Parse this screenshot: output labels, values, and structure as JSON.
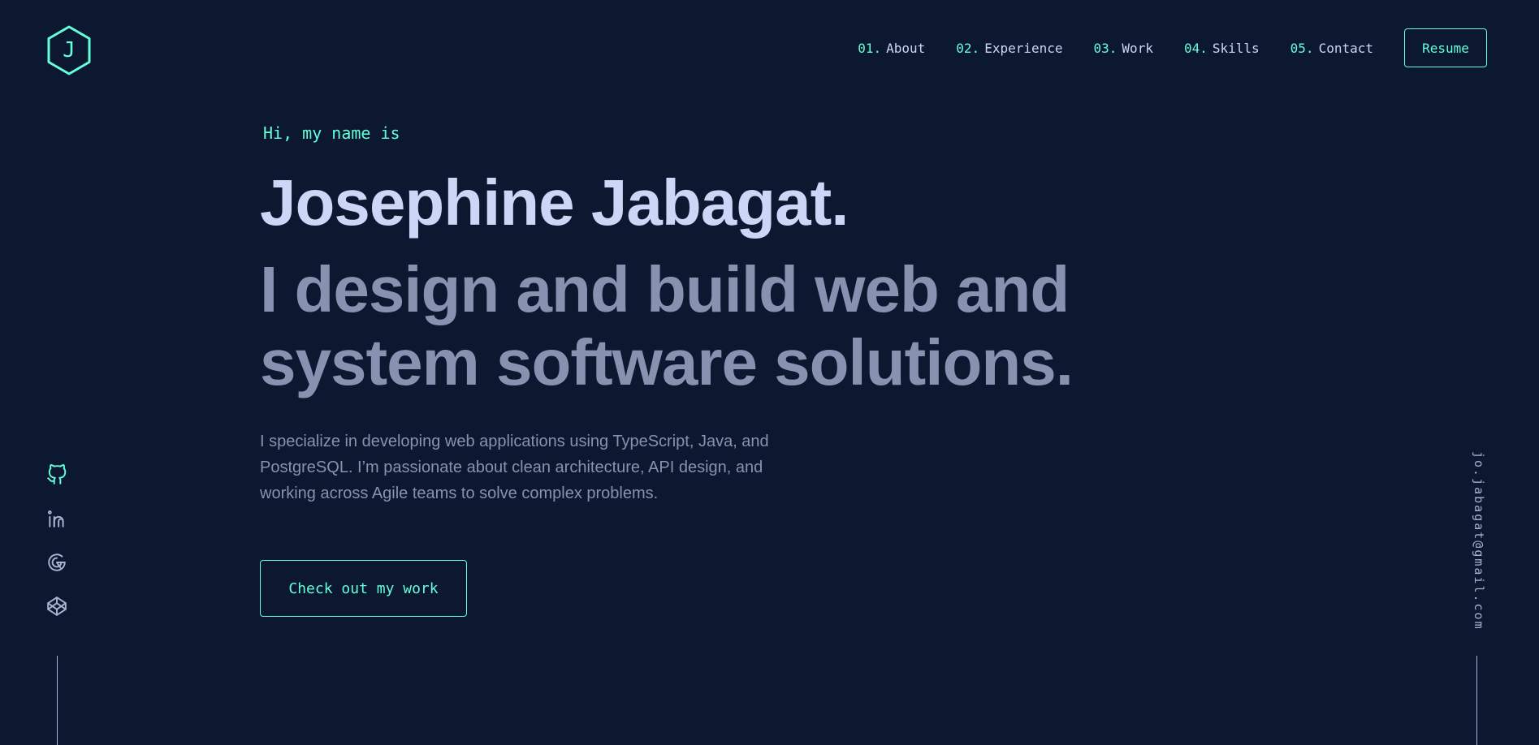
{
  "logo": {
    "letter": "J"
  },
  "nav": {
    "items": [
      {
        "num": "01.",
        "label": "About"
      },
      {
        "num": "02.",
        "label": "Experience"
      },
      {
        "num": "03.",
        "label": "Work"
      },
      {
        "num": "04.",
        "label": "Skills"
      },
      {
        "num": "05.",
        "label": "Contact"
      }
    ],
    "resume_label": "Resume"
  },
  "hero": {
    "greeting": "Hi, my name is",
    "name": "Josephine Jabagat.",
    "tagline": "I design and build web and system software solutions.",
    "intro": "I specialize in developing web applications using TypeScript, Java, and PostgreSQL. I’m passionate about clean architecture, API design, and working across Agile teams to solve complex problems.",
    "cta_label": "Check out my work"
  },
  "social": {
    "icons": [
      "github-icon",
      "linkedin-icon",
      "gitlab-icon",
      "codepen-icon"
    ]
  },
  "email": "jo.jabagat@gmail.com",
  "colors": {
    "background": "#0b1830",
    "accent": "#64ffda",
    "heading": "#ccd6f6",
    "muted": "#8892b0"
  }
}
